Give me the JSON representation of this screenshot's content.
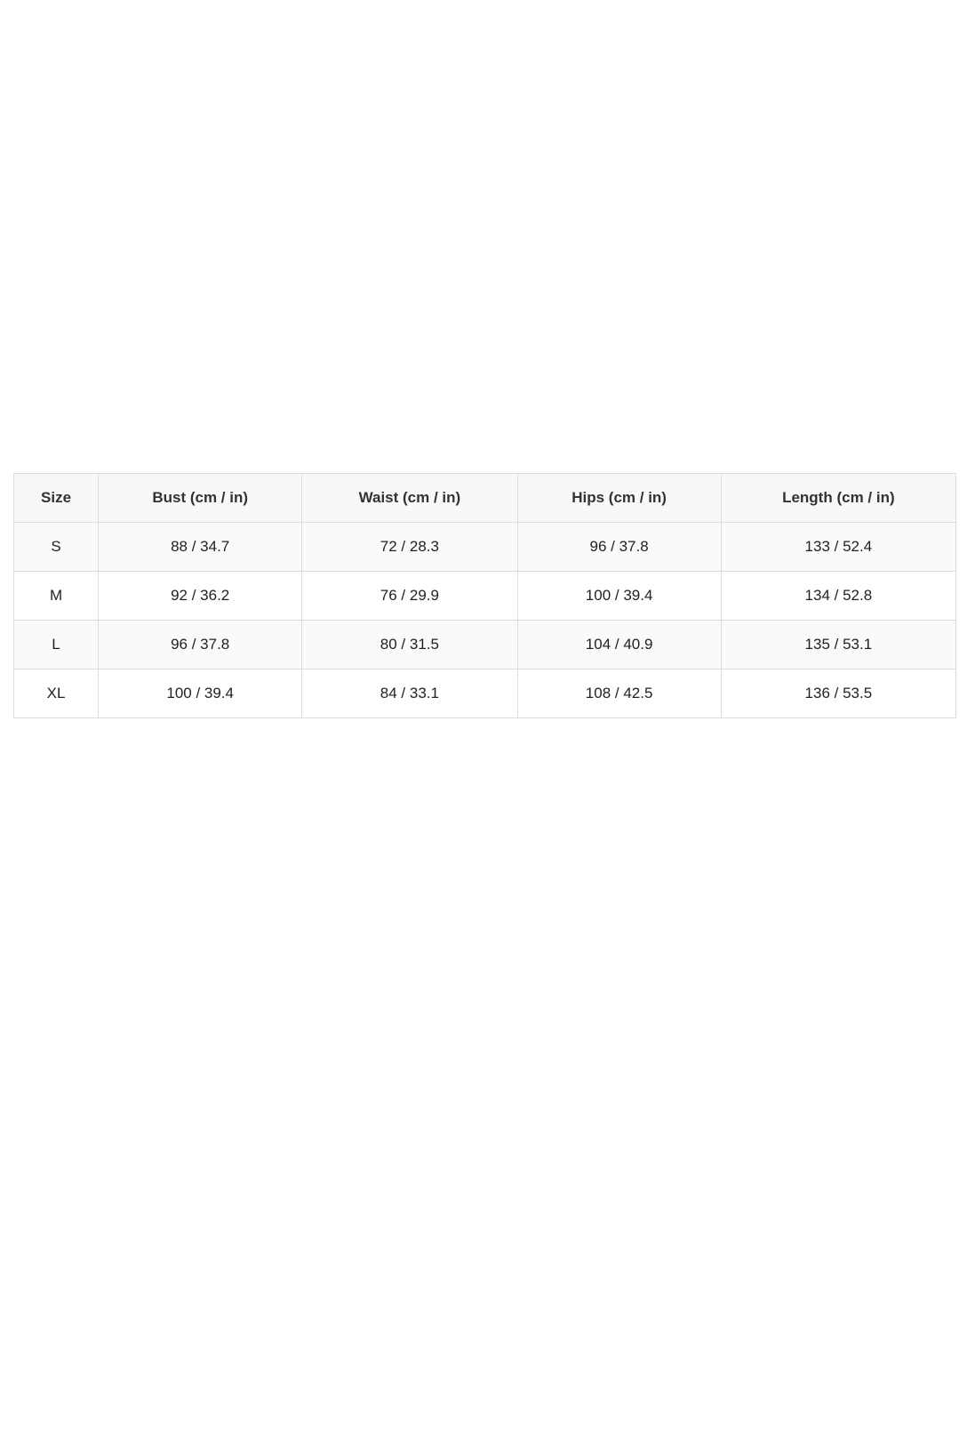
{
  "size_chart": {
    "headers": [
      "Size",
      "Bust (cm / in)",
      "Waist (cm / in)",
      "Hips (cm / in)",
      "Length (cm / in)"
    ],
    "rows": [
      [
        "S",
        "88 / 34.7",
        "72 / 28.3",
        "96 / 37.8",
        "133 / 52.4"
      ],
      [
        "M",
        "92 / 36.2",
        "76 / 29.9",
        "100 / 39.4",
        "134 / 52.8"
      ],
      [
        "L",
        "96 / 37.8",
        "80 / 31.5",
        "104 / 40.9",
        "135 / 53.1"
      ],
      [
        "XL",
        "100 / 39.4",
        "84 / 33.1",
        "108 / 42.5",
        "136 / 53.5"
      ]
    ]
  }
}
